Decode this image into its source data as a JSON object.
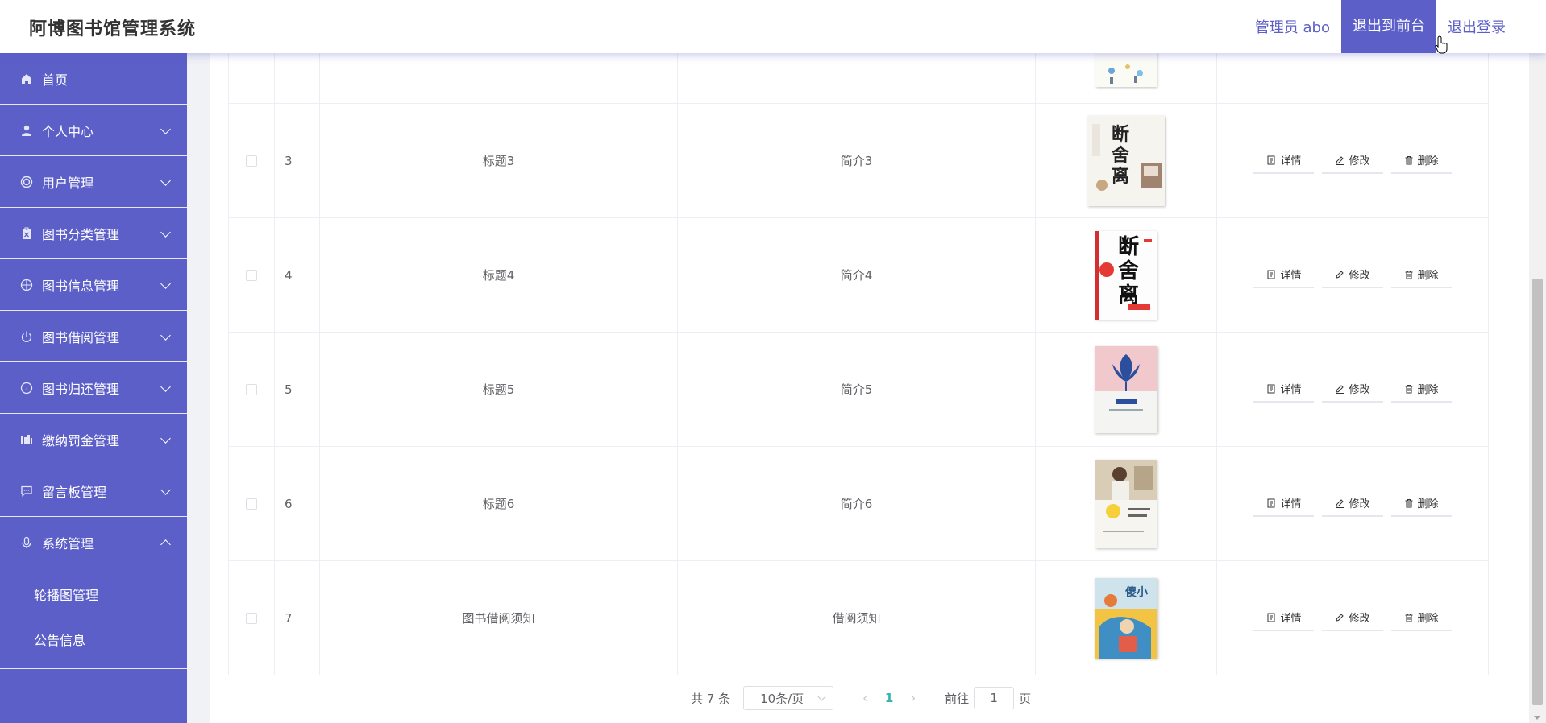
{
  "header": {
    "title": "阿博图书馆管理系统",
    "user": "管理员 abo",
    "front_label": "退出到前台",
    "logout_label": "退出登录"
  },
  "sidebar": {
    "items": [
      {
        "label": "首页",
        "icon": "home-icon"
      },
      {
        "label": "个人中心",
        "icon": "user-icon"
      },
      {
        "label": "用户管理",
        "icon": "circle-icon"
      },
      {
        "label": "图书分类管理",
        "icon": "clipboard-icon"
      },
      {
        "label": "图书信息管理",
        "icon": "globe-icon"
      },
      {
        "label": "图书借阅管理",
        "icon": "power-icon"
      },
      {
        "label": "图书归还管理",
        "icon": "compass-icon"
      },
      {
        "label": "缴纳罚金管理",
        "icon": "bar-icon"
      },
      {
        "label": "留言板管理",
        "icon": "message-icon"
      },
      {
        "label": "系统管理",
        "icon": "mic-icon"
      }
    ],
    "sub_items": [
      {
        "label": "轮播图管理"
      },
      {
        "label": "公告信息"
      }
    ]
  },
  "table": {
    "ops": {
      "detail": "详情",
      "edit": "修改",
      "delete": "删除"
    },
    "rows": [
      {
        "index": "3",
        "title": "标题3",
        "desc": "简介3"
      },
      {
        "index": "4",
        "title": "标题4",
        "desc": "简介4"
      },
      {
        "index": "5",
        "title": "标题5",
        "desc": "简介5"
      },
      {
        "index": "6",
        "title": "标题6",
        "desc": "简介6"
      },
      {
        "index": "7",
        "title": "图书借阅须知",
        "desc": "借阅须知"
      }
    ]
  },
  "pagination": {
    "total": "共 7 条",
    "page_size": "10条/页",
    "current": "1",
    "goto_prefix": "前往",
    "goto_value": "1",
    "goto_suffix": "页"
  },
  "colors": {
    "brand": "#5b5fc7",
    "active_page": "#38b4b0"
  }
}
